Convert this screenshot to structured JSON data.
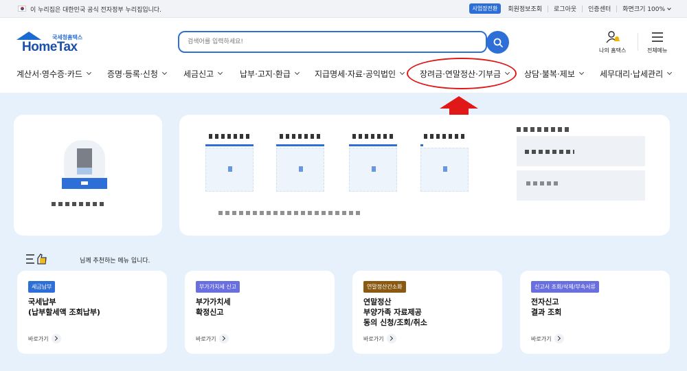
{
  "gov_bar": {
    "notice": "이 누리집은 대한민국 공식 전자정부 누리집입니다.",
    "business_button": "사업장전환",
    "links": [
      "회원정보조회",
      "로그아웃",
      "인증센터"
    ],
    "screen_size": "화면크기 100%"
  },
  "logo": {
    "sub": "국세청홈택스",
    "main": "HomeTax"
  },
  "search": {
    "placeholder": "검색어를 입력하세요!"
  },
  "utilities": {
    "my_hometax": "나의 홈택스",
    "all_menu": "전체메뉴"
  },
  "nav": [
    "계산서·영수증·카드",
    "증명·등록·신청",
    "세금신고",
    "납부·고지·환급",
    "지급명세·자료·공익법인",
    "장려금·연말정산·기부금",
    "상담·불복·제보",
    "세무대리·납세관리"
  ],
  "recommend": {
    "text": "님께 추천하는 메뉴 입니다."
  },
  "menu_cards": [
    {
      "tag": "세금납부",
      "tag_color": "#2d6fd6",
      "title": "국세납부\n(납부할세액 조회납부)",
      "go": "바로가기"
    },
    {
      "tag": "부가가치세 신고",
      "tag_color": "#6a6fe0",
      "title": "부가가치세\n확정신고",
      "go": "바로가기"
    },
    {
      "tag": "연말정산간소화",
      "tag_color": "#8a5a12",
      "title": "연말정산\n부양가족 자료제공\n동의 신청/조회/취소",
      "go": "바로가기"
    },
    {
      "tag": "신고서 조회/삭제/부속서류",
      "tag_color": "#6a6fe0",
      "title": "전자신고\n결과 조회",
      "go": "바로가기"
    }
  ],
  "colors": {
    "accent": "#2d6fd6",
    "highlight": "#e01818",
    "background": "#e7f1fb"
  }
}
